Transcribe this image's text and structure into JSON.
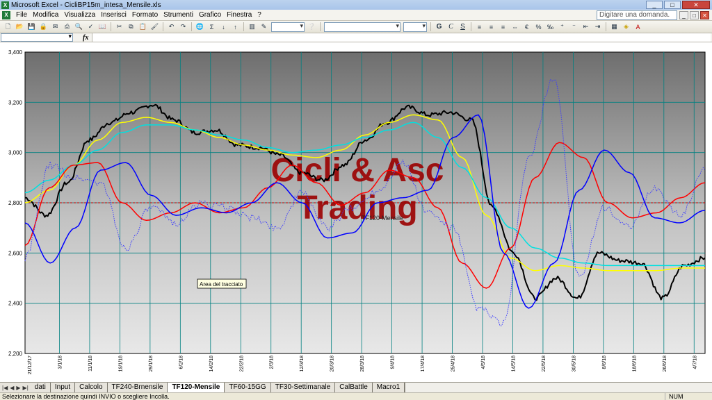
{
  "window": {
    "title": "Microsoft Excel - CicliBP15m_intesa_Mensile.xls",
    "controls": [
      "_",
      "□",
      "✕"
    ]
  },
  "menu": {
    "items": [
      "File",
      "Modifica",
      "Visualizza",
      "Inserisci",
      "Formato",
      "Strumenti",
      "Grafico",
      "Finestra",
      "?"
    ],
    "help_placeholder": "Digitare una domanda.",
    "doc_controls": [
      "_",
      "□",
      "✕"
    ]
  },
  "toolbar": {
    "fx_label": "fx"
  },
  "chart_data": {
    "type": "line",
    "title": "Cicli & Asc Trading",
    "watermark_lines": [
      "Cicli & Asc",
      "Trading"
    ],
    "overlay_label": "TF120-Mensile",
    "tooltip": "Area del tracciato",
    "ylim": [
      2.2,
      3.4
    ],
    "yticks": [
      "3,400",
      "3,200",
      "3,000",
      "2,800",
      "2,600",
      "2,400",
      "2,200"
    ],
    "reference_line": 2.8,
    "reference_color": "#c00000",
    "x_dates": [
      "21/12/17",
      "3/1/18",
      "11/1/18",
      "19/1/18",
      "29/1/18",
      "6/2/18",
      "14/2/18",
      "22/2/18",
      "2/3/18",
      "12/3/18",
      "20/3/18",
      "28/3/18",
      "9/4/18",
      "17/4/18",
      "25/4/18",
      "4/5/18",
      "14/5/18",
      "22/5/18",
      "30/5/18",
      "8/6/18",
      "18/6/18",
      "26/6/18",
      "4/7/18"
    ],
    "grid": true,
    "series": [
      {
        "name": "",
        "color": "#000000",
        "values": [
          2.82,
          2.75,
          2.88,
          3.05,
          3.12,
          3.16,
          3.19,
          3.13,
          3.08,
          3.09,
          3.03,
          3.02,
          2.99,
          2.92,
          2.89,
          2.95,
          3.05,
          3.12,
          3.18,
          3.15,
          3.16,
          3.13,
          2.78,
          2.6,
          2.42,
          2.5,
          2.42,
          2.6,
          2.57,
          2.56,
          2.42,
          2.55,
          2.58
        ]
      },
      {
        "name": "",
        "color": "#ffff00",
        "values": [
          2.8,
          2.85,
          2.95,
          3.05,
          3.12,
          3.14,
          3.12,
          3.09,
          3.06,
          3.03,
          3.01,
          2.99,
          2.98,
          3.01,
          3.07,
          3.12,
          3.15,
          3.13,
          2.98,
          2.75,
          2.58,
          2.53,
          2.55,
          2.54,
          2.53,
          2.53,
          2.53,
          2.54,
          2.54
        ]
      },
      {
        "name": "",
        "color": "#00e0e0",
        "values": [
          2.84,
          2.89,
          2.95,
          3.01,
          3.08,
          3.11,
          3.11,
          3.09,
          3.07,
          3.05,
          3.02,
          3.0,
          3.01,
          3.03,
          3.06,
          3.09,
          3.12,
          3.06,
          2.94,
          2.82,
          2.7,
          2.62,
          2.58,
          2.56,
          2.55,
          2.55,
          2.55,
          2.55,
          2.55
        ]
      },
      {
        "name": "",
        "color": "#ff0000",
        "values": [
          2.63,
          2.86,
          2.95,
          2.96,
          2.8,
          2.73,
          2.76,
          2.8,
          2.76,
          2.78,
          2.86,
          2.95,
          2.88,
          2.79,
          2.84,
          2.93,
          2.9,
          2.78,
          2.56,
          2.46,
          2.62,
          2.9,
          3.04,
          2.98,
          2.8,
          2.74,
          2.76,
          2.82,
          2.88
        ]
      },
      {
        "name": "",
        "color": "#0000ff",
        "values": [
          2.72,
          2.56,
          2.7,
          2.93,
          2.96,
          2.83,
          2.75,
          2.78,
          2.76,
          2.8,
          2.88,
          2.8,
          2.66,
          2.68,
          2.8,
          2.82,
          2.85,
          3.06,
          3.15,
          2.6,
          2.38,
          2.56,
          2.85,
          3.01,
          2.92,
          2.74,
          2.72,
          2.77
        ]
      },
      {
        "name": "",
        "color": "#3a3aff",
        "dashed": true,
        "values": [
          2.58,
          2.95,
          2.9,
          2.88,
          2.62,
          2.78,
          2.72,
          2.8,
          2.78,
          2.74,
          2.7,
          2.84,
          2.7,
          2.78,
          2.85,
          2.96,
          2.76,
          2.7,
          2.38,
          2.32,
          2.98,
          3.3,
          2.5,
          2.78,
          2.7,
          2.86,
          2.75,
          2.93
        ]
      }
    ]
  },
  "sheets": {
    "tabs": [
      "dati",
      "Input",
      "Calcolo",
      "TF240-Brnensile",
      "TF120-Mensile",
      "TF60-15GG",
      "TF30-Settimanale",
      "CalBattle",
      "Macro1"
    ],
    "active": "TF120-Mensile"
  },
  "status": {
    "message": "Selezionare la destinazione quindi INVIO o scegliere Incolla.",
    "num": "NUM"
  }
}
